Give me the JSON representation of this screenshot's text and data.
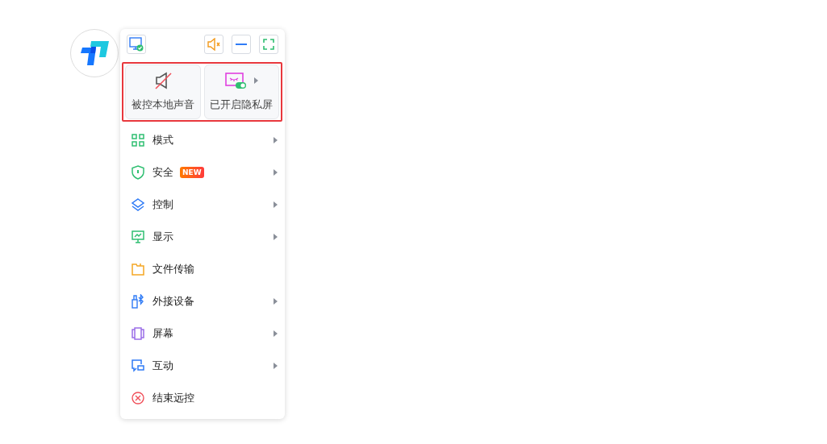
{
  "toolbar": {
    "speaker_muted": true
  },
  "quick_actions": {
    "highlighted": true,
    "tiles": [
      {
        "label": "被控本地声音",
        "muted": true,
        "has_submenu": false
      },
      {
        "label": "已开启隐私屏",
        "on": true,
        "has_submenu": true
      }
    ]
  },
  "menu": [
    {
      "label": "模式",
      "has_submenu": true
    },
    {
      "label": "安全",
      "badge": "NEW",
      "has_submenu": true
    },
    {
      "label": "控制",
      "has_submenu": true
    },
    {
      "label": "显示",
      "has_submenu": true
    },
    {
      "label": "文件传输",
      "has_submenu": false
    },
    {
      "label": "外接设备",
      "has_submenu": true
    },
    {
      "label": "屏幕",
      "has_submenu": true
    },
    {
      "label": "互动",
      "has_submenu": true
    },
    {
      "label": "结束远控",
      "has_submenu": false
    }
  ]
}
